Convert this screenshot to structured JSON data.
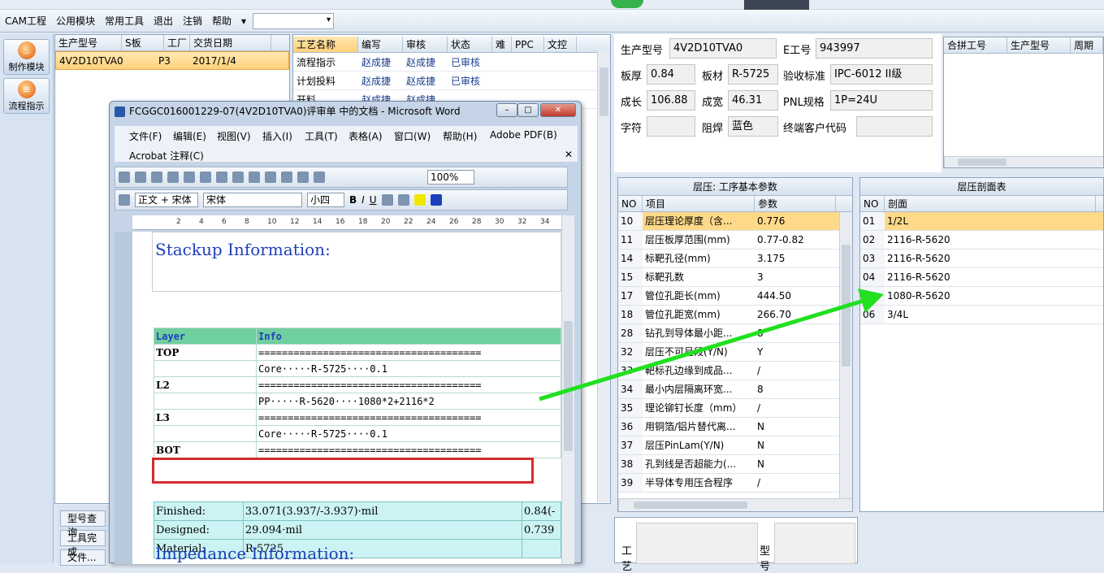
{
  "menubar": {
    "items": [
      "CAM工程",
      "公用模块",
      "常用工具",
      "退出",
      "注销",
      "帮助"
    ],
    "more": "▾"
  },
  "leftbar": {
    "btn1": "制作模块",
    "btn2": "流程指示"
  },
  "bottomleft": {
    "b1": "型号查询",
    "b2": "工具完成",
    "b3": "文件..."
  },
  "job": {
    "headers": [
      "生产型号",
      "S板",
      "工厂",
      "交货日期"
    ],
    "row": [
      "4V2D10TVA0",
      "",
      "P3",
      "2017/1/4"
    ]
  },
  "process": {
    "headers": [
      "工艺名称",
      "编写",
      "审核",
      "状态",
      "难",
      "PPC",
      "文控"
    ],
    "rows": [
      [
        "流程指示",
        "赵成捷",
        "赵成捷",
        "已审核"
      ],
      [
        "计划投料",
        "赵成捷",
        "赵成捷",
        "已审核"
      ],
      [
        "开料",
        "赵成捷",
        "赵成捷",
        ""
      ]
    ]
  },
  "info": {
    "prod_lbl": "生产型号",
    "prod": "4V2D10TVA0",
    "eno_lbl": "E工号",
    "eno": "943997",
    "thick_lbl": "板厚",
    "thick": "0.84",
    "mat_lbl": "板材",
    "mat": "R-5725",
    "std_lbl": "验收标准",
    "std": "IPC-6012 II级",
    "len_lbl": "成长",
    "len": "106.88",
    "wid_lbl": "成宽",
    "wid": "46.31",
    "pnl_lbl": "PNL规格",
    "pnl": "1P=24U",
    "char_lbl": "字符",
    "char": "",
    "mask_lbl": "阻焊",
    "mask": "蓝色",
    "cust_lbl": "终端客户代码",
    "cust": ""
  },
  "merge": {
    "headers": [
      "合拼工号",
      "生产型号",
      "周期"
    ]
  },
  "params": {
    "title": "层压: 工序基本参数",
    "headers": [
      "NO",
      "项目",
      "参数"
    ],
    "rows": [
      [
        "10",
        "层压理论厚度（含...",
        "0.776"
      ],
      [
        "11",
        "层压板厚范围(mm)",
        "0.77-0.82"
      ],
      [
        "14",
        "标靶孔径(mm)",
        "3.175"
      ],
      [
        "15",
        "标靶孔数",
        "3"
      ],
      [
        "17",
        "管位孔距长(mm)",
        "444.50"
      ],
      [
        "18",
        "管位孔距宽(mm)",
        "266.70"
      ],
      [
        "28",
        "钻孔到导体最小距...",
        "8"
      ],
      [
        "32",
        "层压不可呈段(Y/N)",
        "Y"
      ],
      [
        "33",
        "靶标孔边缘到成品...",
        "/"
      ],
      [
        "34",
        "最小内层隔离环宽...",
        "8"
      ],
      [
        "35",
        "理论铆钉长度（mm）",
        "/"
      ],
      [
        "36",
        "用铜箔/铝片替代离...",
        "N"
      ],
      [
        "37",
        "层压PinLam(Y/N)",
        "N"
      ],
      [
        "38",
        "孔到线是否超能力(...",
        "N"
      ],
      [
        "39",
        "半导体专用压合程序",
        "/"
      ]
    ]
  },
  "section": {
    "title": "层压剖面表",
    "headers": [
      "NO",
      "剖面"
    ],
    "rows": [
      [
        "01",
        "1/2L"
      ],
      [
        "02",
        "2116-R-5620"
      ],
      [
        "03",
        "2116-R-5620"
      ],
      [
        "04",
        "2116-R-5620"
      ],
      [
        "",
        "1080-R-5620"
      ],
      [
        "06",
        "3/4L"
      ]
    ]
  },
  "bottompanel": {
    "lbl1": "工艺",
    "lbl2": "型号"
  },
  "word": {
    "title": "FCGGC016001229-07(4V2D10TVA0)评审单 中的文档 - Microsoft Word",
    "menu": [
      "文件(F)",
      "编辑(E)",
      "视图(V)",
      "插入(I)",
      "工具(T)",
      "表格(A)",
      "窗口(W)",
      "帮助(H)",
      "Adobe PDF(B)"
    ],
    "acrobat": "Acrobat 注释(C)",
    "zoom": "100%",
    "style": "正文 + 宋体",
    "font": "宋体",
    "size": "小四",
    "ruler": [
      "2",
      "4",
      "6",
      "8",
      "10",
      "12",
      "14",
      "16",
      "18",
      "20",
      "22",
      "24",
      "26",
      "28",
      "30",
      "32",
      "34"
    ],
    "heading1": "Stackup Information:",
    "stack_hdr": [
      "Layer",
      "Info"
    ],
    "stack": [
      [
        "TOP",
        "======================================"
      ],
      [
        "",
        "Core·····R-5725····0.1"
      ],
      [
        "L2",
        "======================================"
      ],
      [
        "",
        "PP·····R-5620····1080*2+2116*2"
      ],
      [
        "L3",
        "======================================"
      ],
      [
        "",
        "Core·····R-5725····0.1"
      ],
      [
        "BOT",
        "======================================"
      ]
    ],
    "ct": [
      [
        "Finished:",
        "33.071(3.937/-3.937)·mil",
        "0.84(-"
      ],
      [
        "Designed:",
        "29.094·mil",
        "0.739"
      ],
      [
        "Material:",
        "R-5725",
        ""
      ]
    ],
    "heading2": "Impedance Information:"
  }
}
